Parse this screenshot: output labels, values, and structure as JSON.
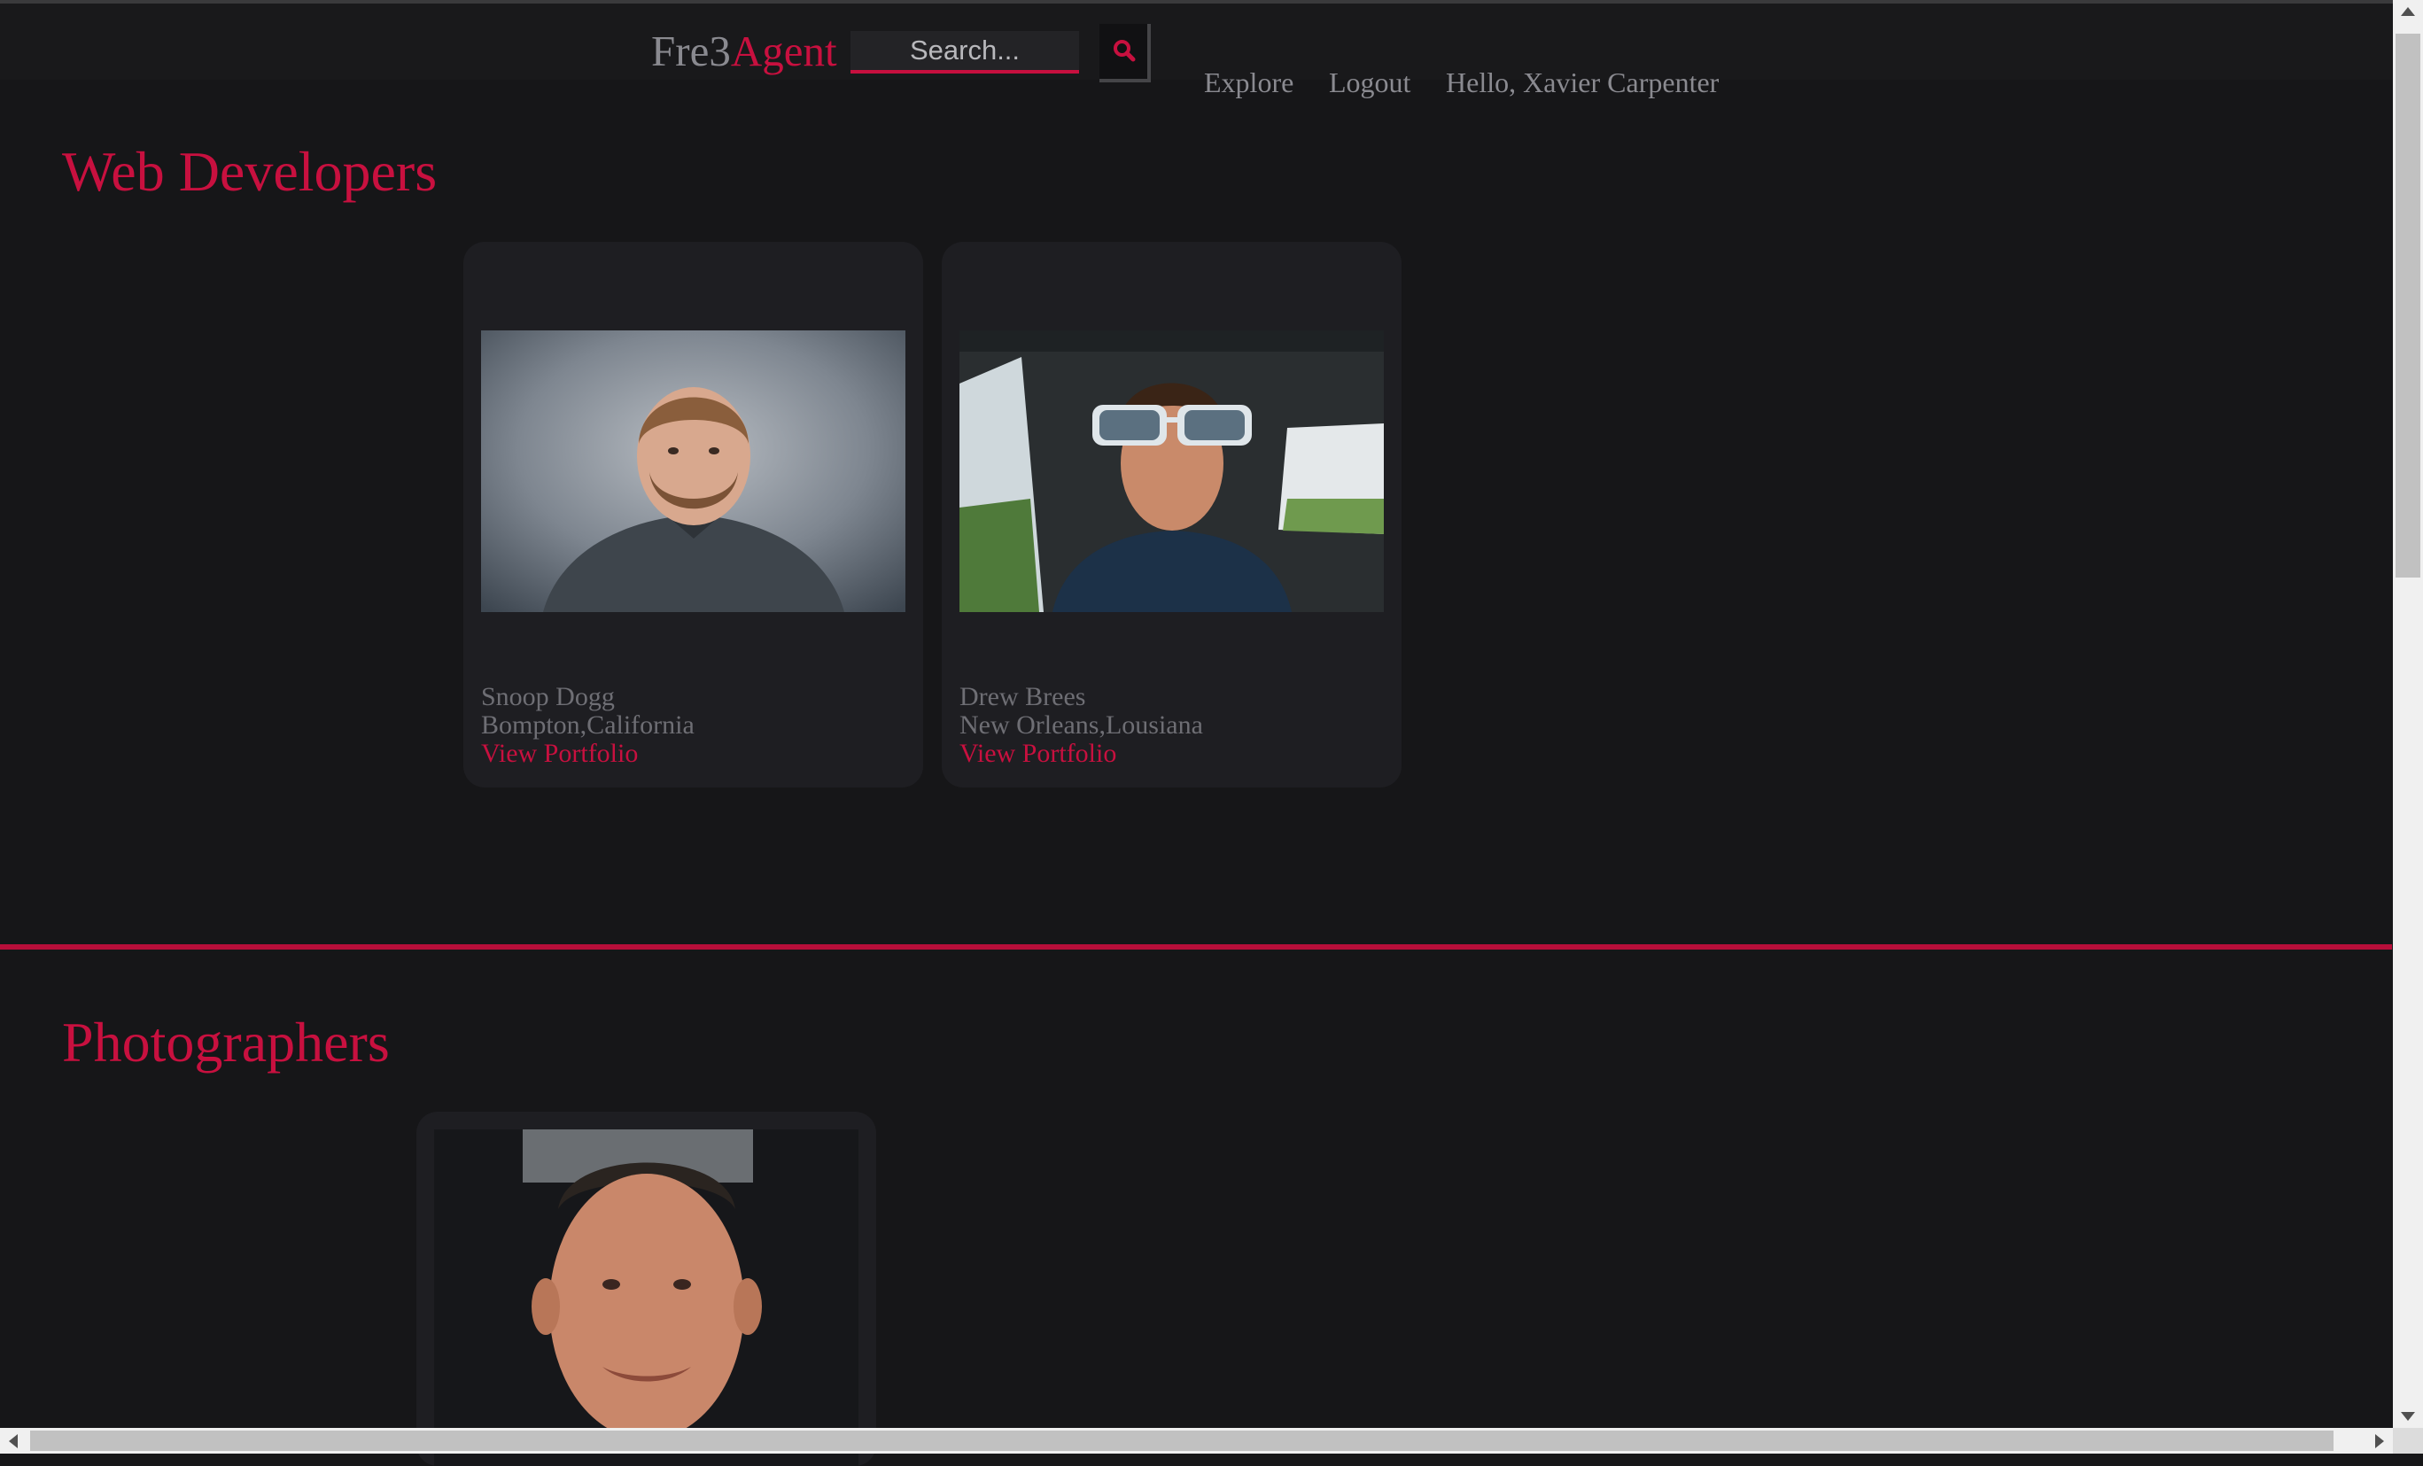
{
  "header": {
    "brand_part1": "Fre3",
    "brand_part2": "Agent",
    "search_placeholder": "Search...",
    "search_icon": "search-icon",
    "nav": {
      "explore": "Explore",
      "logout": "Logout",
      "greeting": "Hello, Xavier Carpenter"
    }
  },
  "sections": [
    {
      "title": "Web Developers",
      "cards": [
        {
          "name": "Snoop Dogg",
          "location": "Bompton,California",
          "link_label": "View Portfolio"
        },
        {
          "name": "Drew Brees",
          "location": "New Orleans,Lousiana",
          "link_label": "View Portfolio"
        }
      ]
    },
    {
      "title": "Photographers",
      "cards": [
        {
          "name": "",
          "location": "",
          "link_label": ""
        }
      ]
    }
  ],
  "colors": {
    "accent": "#c8103f",
    "background": "#161618",
    "card": "#1e1e22",
    "muted_text": "#6e6e74"
  }
}
